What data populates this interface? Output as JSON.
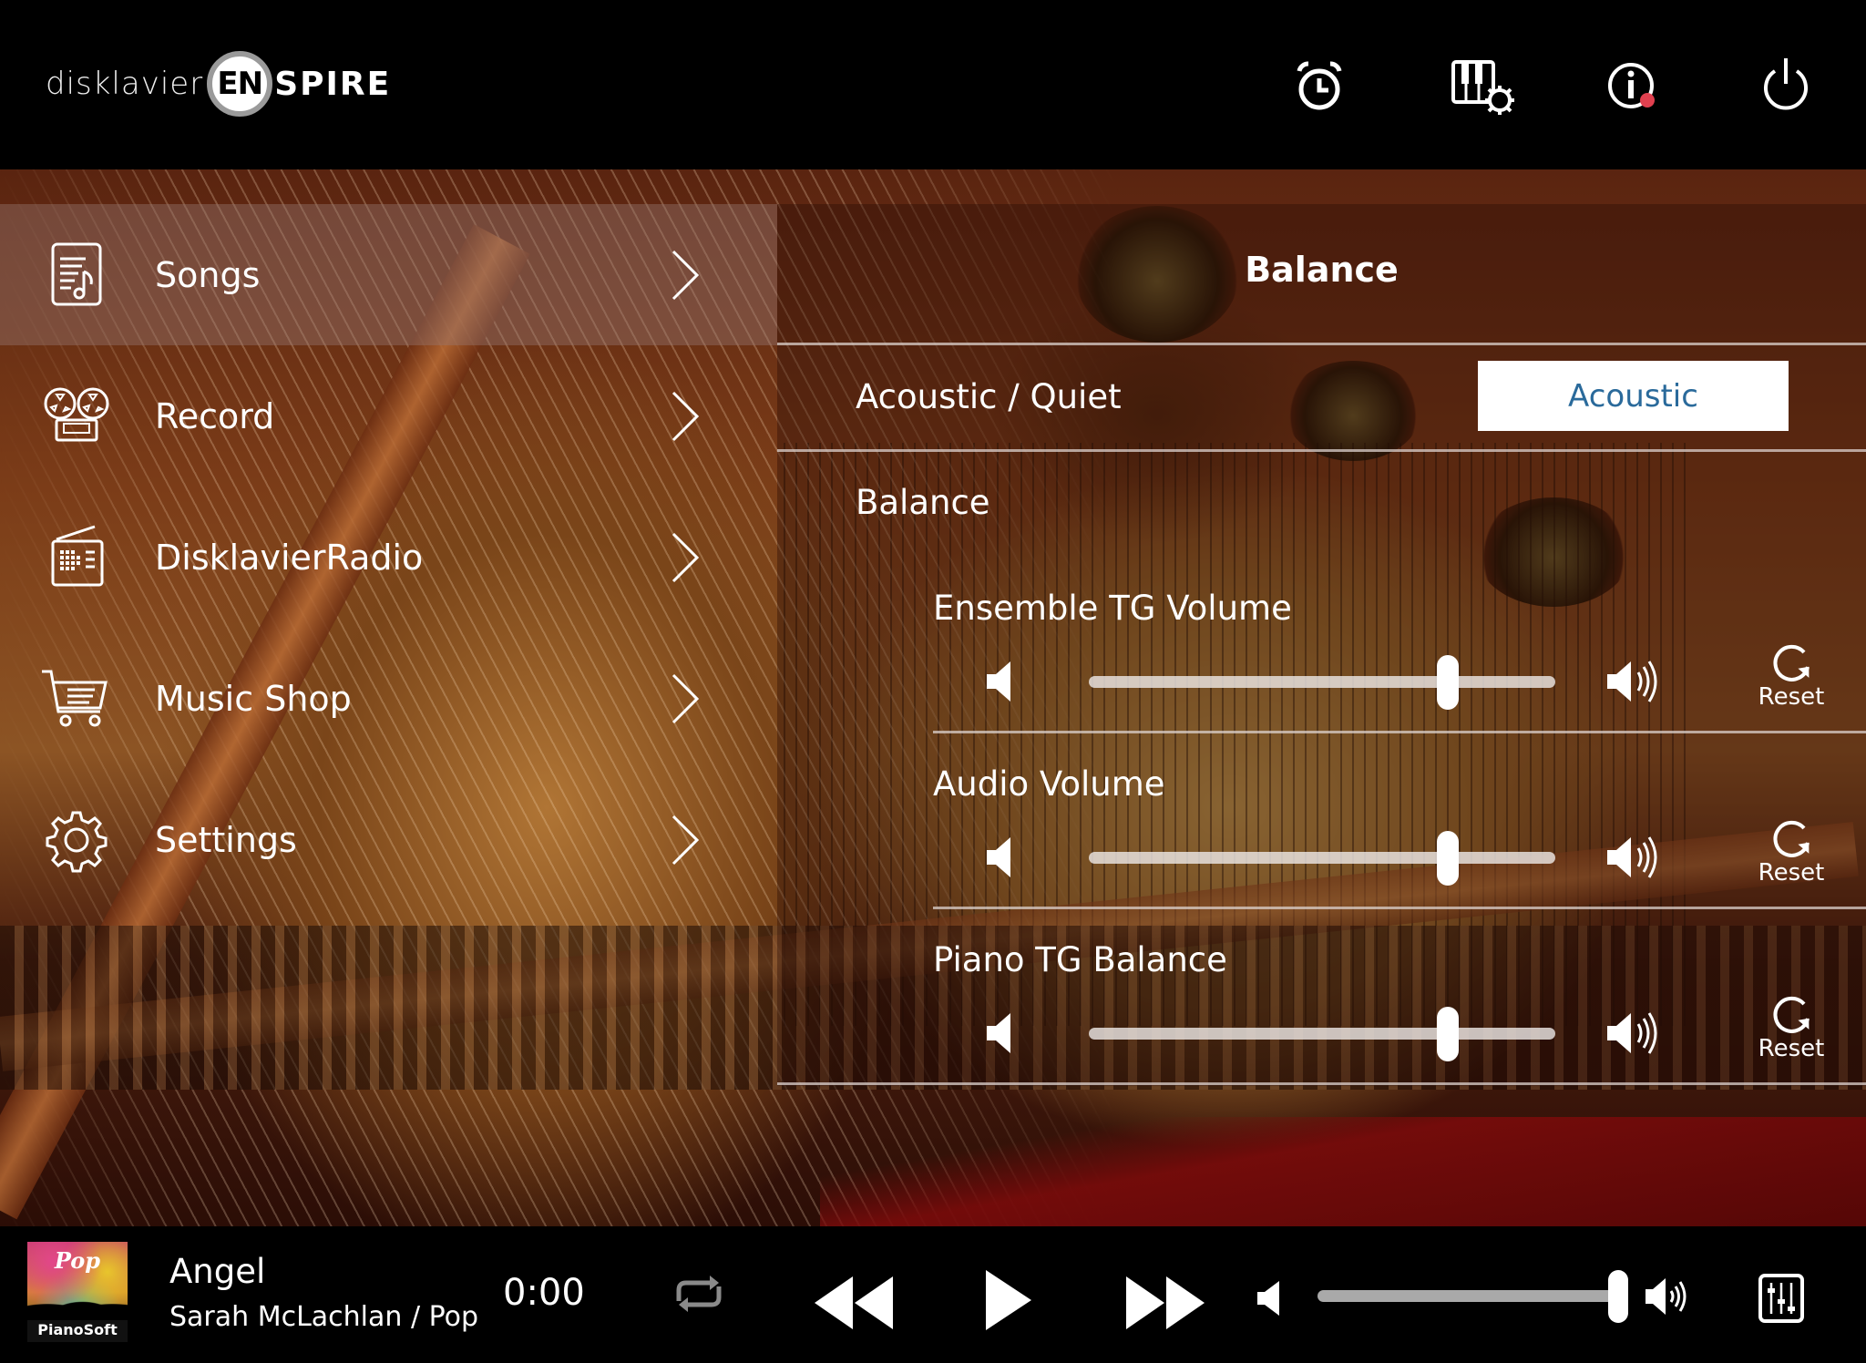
{
  "header": {
    "logo": {
      "prefix": "disklavier",
      "badge": "EN",
      "suffix": "SPIRE"
    },
    "icons": [
      {
        "name": "alarm-clock-icon",
        "label": "Timer"
      },
      {
        "name": "piano-settings-icon",
        "label": "Piano Settings"
      },
      {
        "name": "info-icon",
        "label": "Information",
        "has_notification": true,
        "notification_color": "#e0404f"
      },
      {
        "name": "power-icon",
        "label": "Power"
      }
    ]
  },
  "sidebar": {
    "items": [
      {
        "label": "Songs",
        "icon": "song-list-icon",
        "selected": true
      },
      {
        "label": "Record",
        "icon": "tape-reel-icon",
        "selected": false
      },
      {
        "label": "DisklavierRadio",
        "icon": "radio-icon",
        "selected": false
      },
      {
        "label": "Music Shop",
        "icon": "shopping-cart-icon",
        "selected": false
      },
      {
        "label": "Settings",
        "icon": "gear-icon",
        "selected": false
      }
    ]
  },
  "panel": {
    "title": "Balance",
    "acoustic_quiet": {
      "label": "Acoustic / Quiet",
      "value": "Acoustic"
    },
    "balance_label": "Balance",
    "sliders": [
      {
        "label": "Ensemble TG Volume",
        "value_percent": 77,
        "reset_label": "Reset"
      },
      {
        "label": "Audio Volume",
        "value_percent": 77,
        "reset_label": "Reset"
      },
      {
        "label": "Piano TG Balance",
        "value_percent": 77,
        "reset_label": "Reset"
      }
    ]
  },
  "player": {
    "album_art": {
      "genre_text": "Pop",
      "brand_text": "PianoSoft"
    },
    "song_title": "Angel",
    "song_subtitle": "Sarah McLachlan / Pop",
    "elapsed_time": "0:00",
    "repeat_enabled": false,
    "volume_percent": 100
  },
  "colors": {
    "accent_text": "#2a6a9b",
    "header_bg": "#000000",
    "selected_row": "rgba(150,120,115,0.42)"
  }
}
